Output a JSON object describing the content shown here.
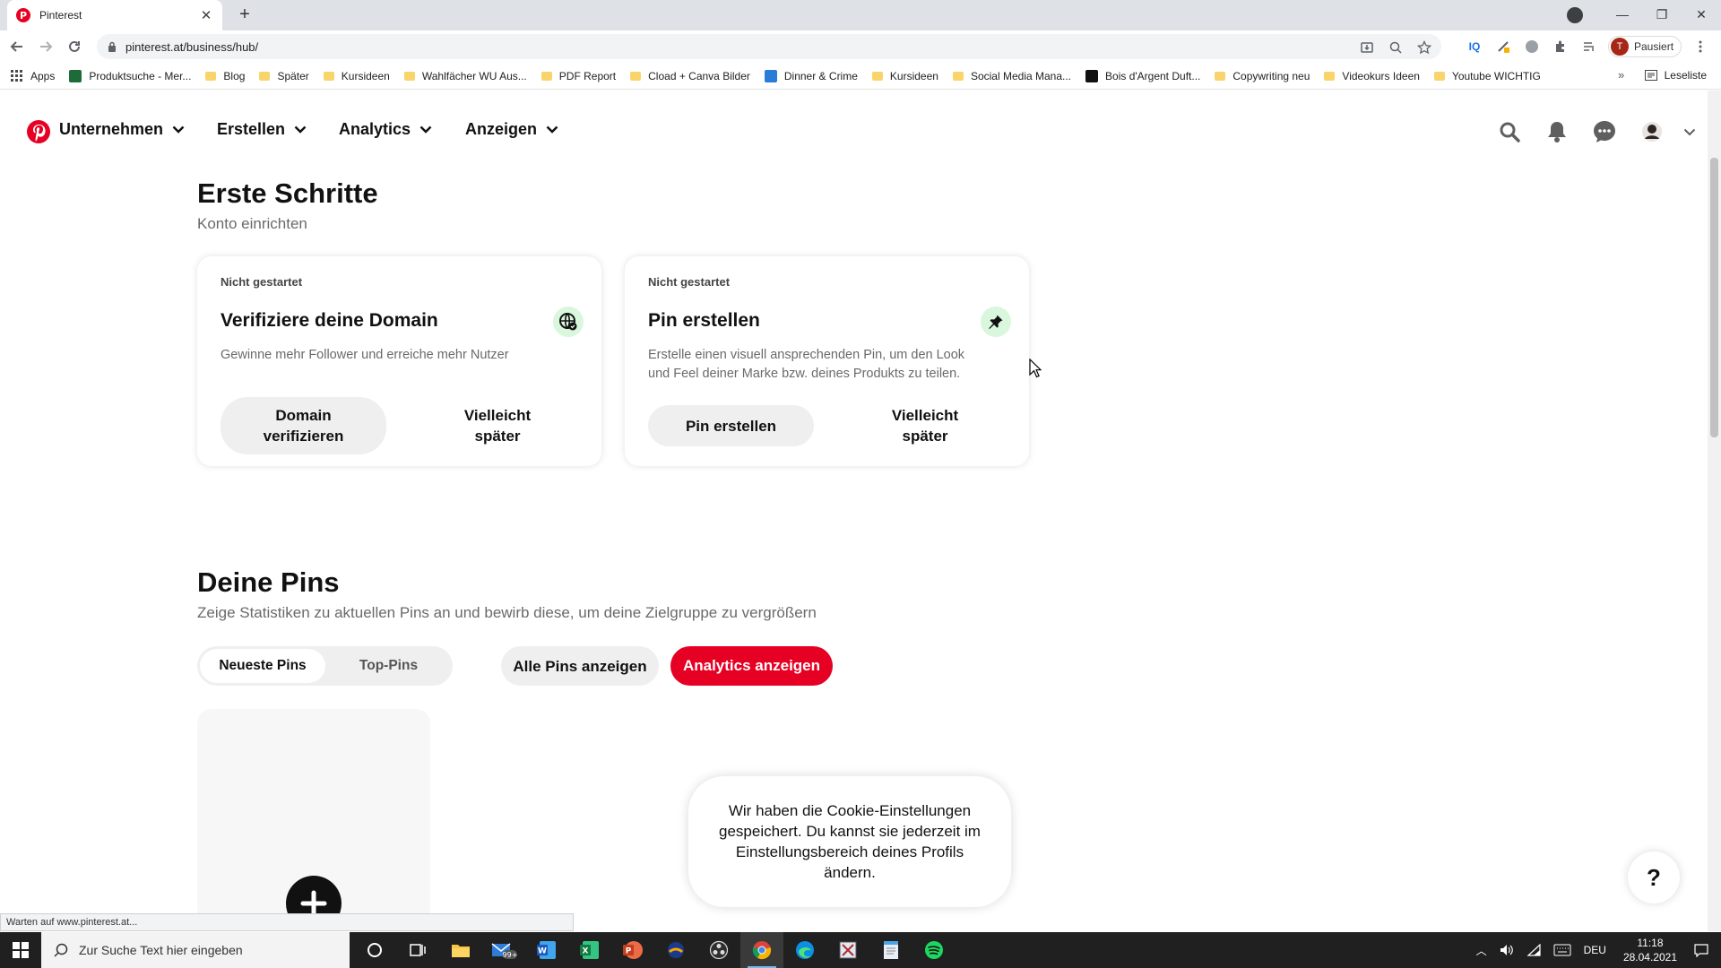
{
  "browser": {
    "tab_title": "Pinterest",
    "url": "pinterest.at/business/hub/",
    "profile_label": "Pausiert",
    "profile_initial": "T",
    "bookmarks": [
      {
        "label": "Apps",
        "kind": "apps"
      },
      {
        "label": "Produktsuche - Mer...",
        "kind": "site",
        "color": "#1e6b3a"
      },
      {
        "label": "Blog",
        "kind": "folder"
      },
      {
        "label": "Später",
        "kind": "folder"
      },
      {
        "label": "Kursideen",
        "kind": "folder"
      },
      {
        "label": "Wahlfächer WU Aus...",
        "kind": "folder"
      },
      {
        "label": "PDF Report",
        "kind": "folder"
      },
      {
        "label": "Cload + Canva Bilder",
        "kind": "folder"
      },
      {
        "label": "Dinner & Crime",
        "kind": "site",
        "color": "#2b7bd8"
      },
      {
        "label": "Kursideen",
        "kind": "folder"
      },
      {
        "label": "Social Media Mana...",
        "kind": "folder"
      },
      {
        "label": "Bois d'Argent Duft...",
        "kind": "site",
        "color": "#111111"
      },
      {
        "label": "Copywriting neu",
        "kind": "folder"
      },
      {
        "label": "Videokurs Ideen",
        "kind": "folder"
      },
      {
        "label": "Youtube WICHTIG",
        "kind": "folder"
      }
    ],
    "more": "»",
    "reading_list": "Leseliste",
    "status_text": "Warten auf www.pinterest.at..."
  },
  "nav": {
    "items": [
      "Unternehmen",
      "Erstellen",
      "Analytics",
      "Anzeigen"
    ],
    "brand_color": "#e60023"
  },
  "getting_started": {
    "title": "Erste Schritte",
    "subtitle": "Konto einrichten",
    "cards": [
      {
        "status": "Nicht gestartet",
        "title": "Verifiziere deine Domain",
        "description": "Gewinne mehr Follower und erreiche mehr Nutzer",
        "primary_line1": "Domain",
        "primary_line2": "verifizieren",
        "secondary_line1": "Vielleicht",
        "secondary_line2": "später",
        "icon": "globe-icon"
      },
      {
        "status": "Nicht gestartet",
        "title": "Pin erstellen",
        "description": "Erstelle einen visuell ansprechenden Pin, um den Look und Feel deiner Marke bzw. deines Produkts zu teilen.",
        "primary": "Pin erstellen",
        "secondary_line1": "Vielleicht",
        "secondary_line2": "später",
        "icon": "pin-icon"
      }
    ]
  },
  "your_pins": {
    "title": "Deine Pins",
    "subtitle": "Zeige Statistiken zu aktuellen Pins an und bewirb diese, um deine Zielgruppe zu vergrößern",
    "tabs": [
      "Neueste Pins",
      "Top-Pins"
    ],
    "all_pins": "Alle Pins anzeigen",
    "analytics": "Analytics anzeigen"
  },
  "toast": "Wir haben die Cookie-Einstellungen gespeichert. Du kannst sie jederzeit im Einstellungsbereich deines Profils ändern.",
  "help": "?",
  "taskbar": {
    "search_placeholder": "Zur Suche Text hier eingeben",
    "mail_badge": "99+",
    "lang": "DEU",
    "time": "11:18",
    "date": "28.04.2021"
  }
}
